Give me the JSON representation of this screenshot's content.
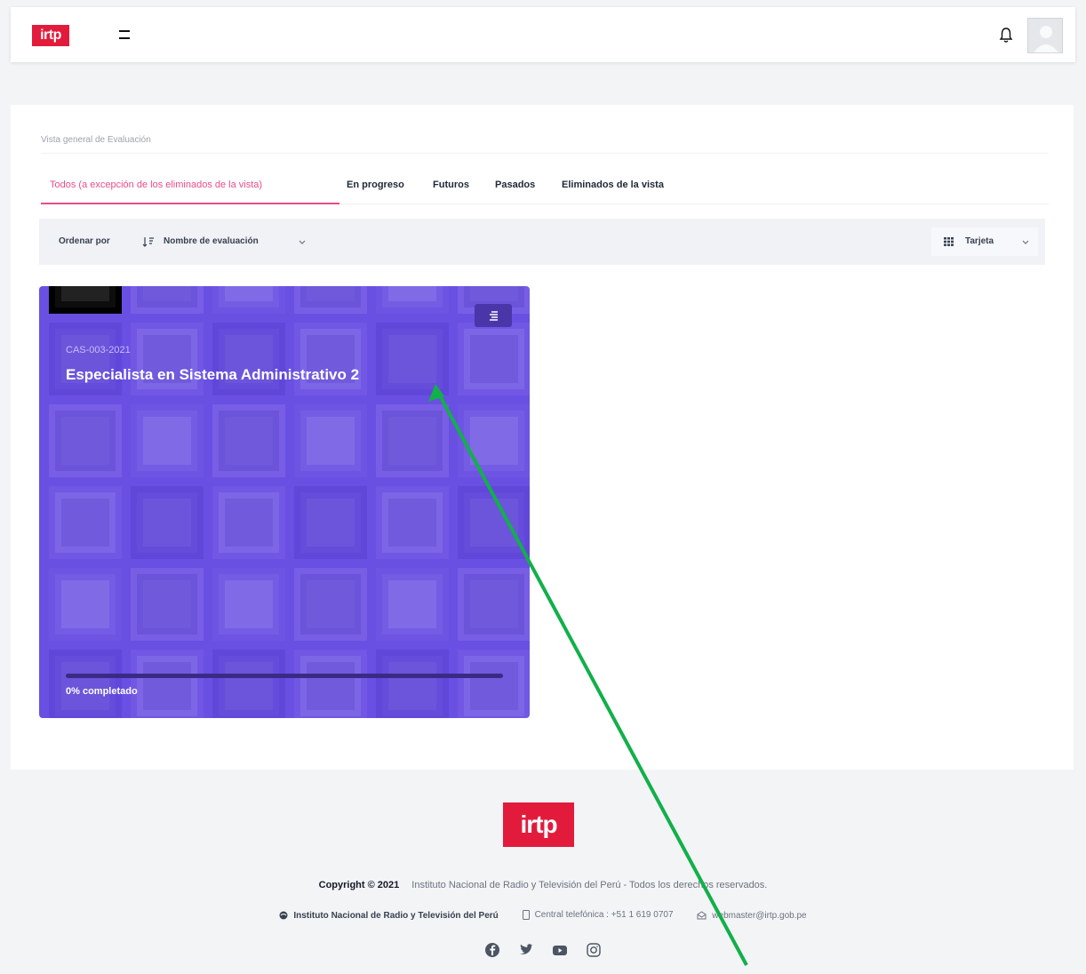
{
  "header": {
    "logo_text": "irtp"
  },
  "page": {
    "title": "Vista general de Evaluación"
  },
  "tabs": [
    {
      "label": "Todos (a excepción de los eliminados de la vista)",
      "active": true
    },
    {
      "label": "En progreso",
      "active": false
    },
    {
      "label": "Futuros",
      "active": false
    },
    {
      "label": "Pasados",
      "active": false
    },
    {
      "label": "Eliminados de la vista",
      "active": false
    }
  ],
  "toolbar": {
    "sort_label": "Ordenar por",
    "sort_value": "Nombre de evaluación",
    "view_value": "Tarjeta"
  },
  "card": {
    "code": "CAS-003-2021",
    "title": "Especialista en Sistema Administrativo 2",
    "progress_percent": 0,
    "progress_text": "0% completado",
    "color": "#6a4fe3"
  },
  "footer": {
    "logo_text": "irtp",
    "copyright_bold": "Copyright © 2021",
    "copyright_text": "Instituto Nacional de Radio y Televisión del Perú - Todos los derechos reservados.",
    "org_name": "Instituto Nacional de Radio y Televisión del Perú",
    "phone": "Central telefónica : +51 1 619 0707",
    "email": "webmaster@irtp.gob.pe",
    "social": [
      "facebook-icon",
      "twitter-icon",
      "youtube-icon",
      "instagram-icon"
    ]
  },
  "colors": {
    "brand": "#e21b3c",
    "tab_active": "#ea4c89",
    "annotation_arrow": "#11b04a"
  }
}
